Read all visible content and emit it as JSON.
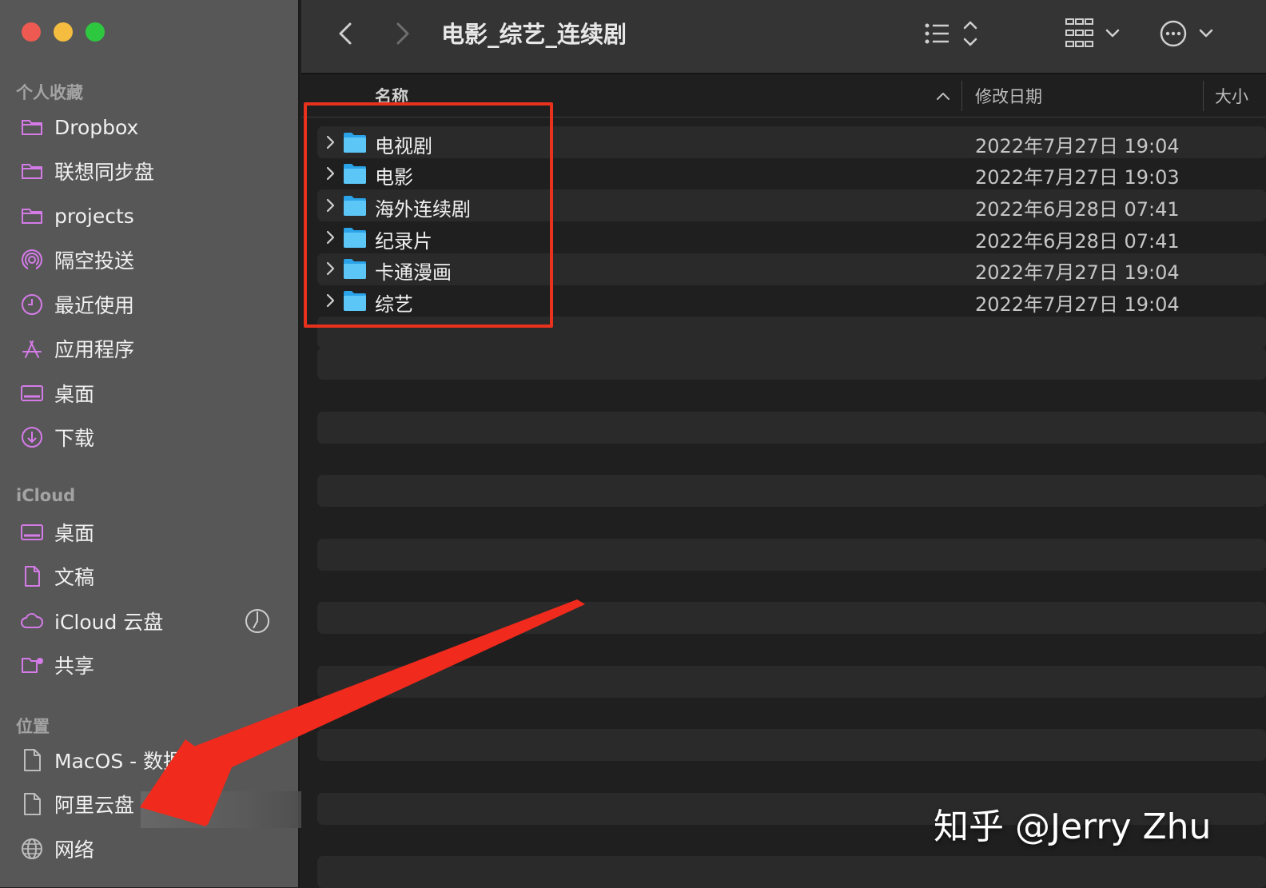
{
  "sidebar": {
    "sections": [
      "个人收藏",
      "iCloud",
      "位置"
    ],
    "favorites": [
      {
        "label": "Dropbox",
        "icon": "folder-icon"
      },
      {
        "label": "联想同步盘",
        "icon": "folder-icon"
      },
      {
        "label": "projects",
        "icon": "folder-icon"
      },
      {
        "label": "隔空投送",
        "icon": "airdrop-icon"
      },
      {
        "label": "最近使用",
        "icon": "clock-icon"
      },
      {
        "label": "应用程序",
        "icon": "apps-icon"
      },
      {
        "label": "桌面",
        "icon": "desktop-icon"
      },
      {
        "label": "下载",
        "icon": "download-icon"
      }
    ],
    "icloud": [
      {
        "label": "桌面",
        "icon": "desktop-icon"
      },
      {
        "label": "文稿",
        "icon": "document-icon"
      },
      {
        "label": "iCloud 云盘",
        "icon": "cloud-icon"
      },
      {
        "label": "共享",
        "icon": "shared-folder-icon"
      }
    ],
    "locations": [
      {
        "label": "MacOS - 数据",
        "icon": "drive-icon"
      },
      {
        "label": "阿里云盘",
        "icon": "drive-icon"
      },
      {
        "label": "网络",
        "icon": "globe-icon"
      }
    ]
  },
  "toolbar": {
    "title": "电影_综艺_连续剧"
  },
  "list": {
    "columns": {
      "name": "名称",
      "modified": "修改日期",
      "size": "大小"
    },
    "rows": [
      {
        "name": "电视剧",
        "modified": "2022年7月27日 19:04"
      },
      {
        "name": "电影",
        "modified": "2022年7月27日 19:03"
      },
      {
        "name": "海外连续剧",
        "modified": "2022年6月28日 07:41"
      },
      {
        "name": "纪录片",
        "modified": "2022年6月28日 07:41"
      },
      {
        "name": "卡通漫画",
        "modified": "2022年7月27日 19:04"
      },
      {
        "name": "综艺",
        "modified": "2022年7月27日 19:04"
      }
    ]
  },
  "watermark": "知乎 @Jerry Zhu",
  "colors": {
    "accent_folder": "#3fb6f2",
    "annotation_red": "#e8321e",
    "sidebar_icon": "#d57be8"
  }
}
